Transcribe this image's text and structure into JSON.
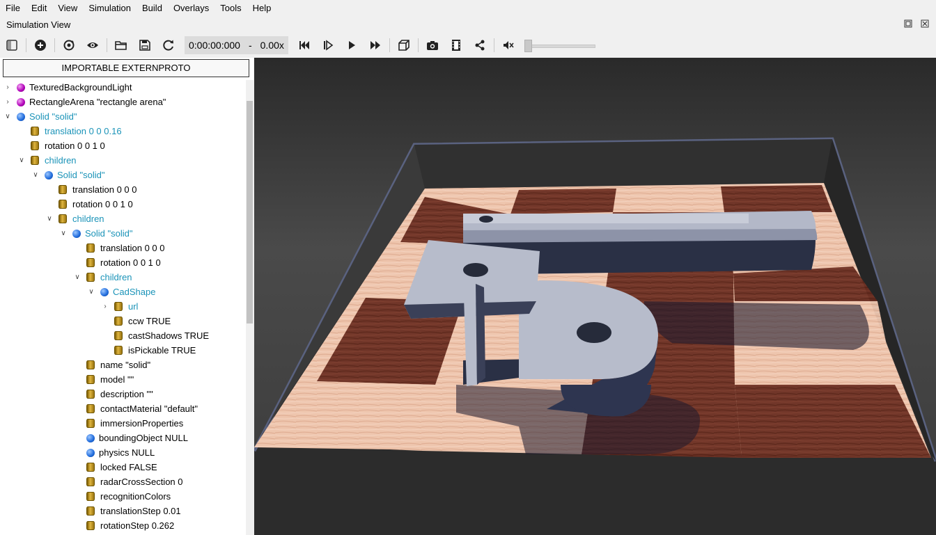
{
  "menu": [
    "File",
    "Edit",
    "View",
    "Simulation",
    "Build",
    "Overlays",
    "Tools",
    "Help"
  ],
  "window_title": "Simulation View",
  "toolbar": {
    "time": "0:00:00:000",
    "dash": "-",
    "speed": "0.00x",
    "icons": [
      "toggle-panel-icon",
      "add-node-icon",
      "reset-view-icon",
      "eye-icon",
      "open-folder-icon",
      "save-icon",
      "reload-icon",
      "step-back-icon",
      "step-icon",
      "play-icon",
      "fast-forward-icon",
      "box-view-icon",
      "screenshot-icon",
      "record-movie-icon",
      "share-icon",
      "mute-icon"
    ],
    "volume": 0
  },
  "import_button": "IMPORTABLE EXTERNPROTO",
  "tree": [
    {
      "label": "TexturedBackgroundLight",
      "icon": "purple",
      "arrow": "collapsed",
      "depth": 0,
      "cyan": false
    },
    {
      "label": "RectangleArena \"rectangle arena\"",
      "icon": "purple",
      "arrow": "collapsed",
      "depth": 0,
      "cyan": false
    },
    {
      "label": "Solid \"solid\"",
      "icon": "blue",
      "arrow": "expanded",
      "depth": 0,
      "cyan": true
    },
    {
      "label": "translation 0 0 0.16",
      "icon": "field",
      "arrow": "none",
      "depth": 1,
      "cyan": true
    },
    {
      "label": "rotation 0 0 1 0",
      "icon": "field",
      "arrow": "none",
      "depth": 1,
      "cyan": false
    },
    {
      "label": "children",
      "icon": "field",
      "arrow": "expanded",
      "depth": 1,
      "cyan": true
    },
    {
      "label": "Solid \"solid\"",
      "icon": "blue",
      "arrow": "expanded",
      "depth": 2,
      "cyan": true
    },
    {
      "label": "translation 0 0 0",
      "icon": "field",
      "arrow": "none",
      "depth": 3,
      "cyan": false
    },
    {
      "label": "rotation 0 0 1 0",
      "icon": "field",
      "arrow": "none",
      "depth": 3,
      "cyan": false
    },
    {
      "label": "children",
      "icon": "field",
      "arrow": "expanded",
      "depth": 3,
      "cyan": true
    },
    {
      "label": "Solid \"solid\"",
      "icon": "blue",
      "arrow": "expanded",
      "depth": 4,
      "cyan": true
    },
    {
      "label": "translation 0 0 0",
      "icon": "field",
      "arrow": "none",
      "depth": 5,
      "cyan": false
    },
    {
      "label": "rotation 0 0 1 0",
      "icon": "field",
      "arrow": "none",
      "depth": 5,
      "cyan": false
    },
    {
      "label": "children",
      "icon": "field",
      "arrow": "expanded",
      "depth": 5,
      "cyan": true
    },
    {
      "label": "CadShape",
      "icon": "blue",
      "arrow": "expanded",
      "depth": 6,
      "cyan": true
    },
    {
      "label": "url",
      "icon": "field",
      "arrow": "collapsed",
      "depth": 7,
      "cyan": true
    },
    {
      "label": "ccw TRUE",
      "icon": "field",
      "arrow": "none",
      "depth": 7,
      "cyan": false
    },
    {
      "label": "castShadows TRUE",
      "icon": "field",
      "arrow": "none",
      "depth": 7,
      "cyan": false
    },
    {
      "label": "isPickable TRUE",
      "icon": "field",
      "arrow": "none",
      "depth": 7,
      "cyan": false
    },
    {
      "label": "name \"solid\"",
      "icon": "field",
      "arrow": "none",
      "depth": 5,
      "cyan": false
    },
    {
      "label": "model \"\"",
      "icon": "field",
      "arrow": "none",
      "depth": 5,
      "cyan": false
    },
    {
      "label": "description \"\"",
      "icon": "field",
      "arrow": "none",
      "depth": 5,
      "cyan": false
    },
    {
      "label": "contactMaterial \"default\"",
      "icon": "field",
      "arrow": "none",
      "depth": 5,
      "cyan": false
    },
    {
      "label": "immersionProperties",
      "icon": "field",
      "arrow": "none",
      "depth": 5,
      "cyan": false
    },
    {
      "label": "boundingObject NULL",
      "icon": "blue",
      "arrow": "none",
      "depth": 5,
      "cyan": false
    },
    {
      "label": "physics NULL",
      "icon": "blue",
      "arrow": "none",
      "depth": 5,
      "cyan": false
    },
    {
      "label": "locked FALSE",
      "icon": "field",
      "arrow": "none",
      "depth": 5,
      "cyan": false
    },
    {
      "label": "radarCrossSection 0",
      "icon": "field",
      "arrow": "none",
      "depth": 5,
      "cyan": false
    },
    {
      "label": "recognitionColors",
      "icon": "field",
      "arrow": "none",
      "depth": 5,
      "cyan": false
    },
    {
      "label": "translationStep 0.01",
      "icon": "field",
      "arrow": "none",
      "depth": 5,
      "cyan": false
    },
    {
      "label": "rotationStep 0.262",
      "icon": "field",
      "arrow": "none",
      "depth": 5,
      "cyan": false
    }
  ]
}
